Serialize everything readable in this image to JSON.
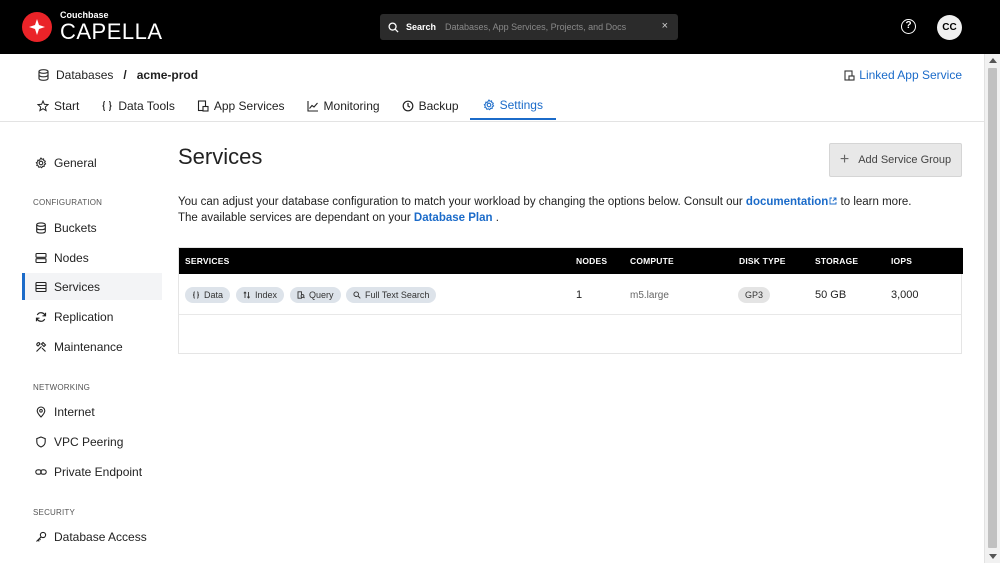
{
  "topbar": {
    "logo_small": "Couchbase",
    "logo_big": "CAPELLA",
    "search_label": "Search",
    "search_placeholder": "Databases, App Services, Projects, and Docs",
    "search_clear": "×",
    "help": "?",
    "avatar": "CC"
  },
  "header": {
    "breadcrumb_root": "Databases",
    "breadcrumb_sep": "/",
    "breadcrumb_current": "acme-prod",
    "linked_app_service": "Linked App Service",
    "tabs": [
      {
        "label": "Start"
      },
      {
        "label": "Data Tools"
      },
      {
        "label": "App Services"
      },
      {
        "label": "Monitoring"
      },
      {
        "label": "Backup"
      },
      {
        "label": "Settings"
      }
    ]
  },
  "sidebar": {
    "general": "General",
    "configuration_title": "CONFIGURATION",
    "configuration_items": [
      "Buckets",
      "Nodes",
      "Services",
      "Replication",
      "Maintenance"
    ],
    "networking_title": "NETWORKING",
    "networking_items": [
      "Internet",
      "VPC Peering",
      "Private Endpoint"
    ],
    "security_title": "SECURITY",
    "security_items": [
      "Database Access"
    ]
  },
  "main": {
    "title": "Services",
    "add_button": "Add Service Group",
    "desc_line1_a": "You can adjust your database configuration to match your workload by changing the options below. Consult our ",
    "desc_link1": "documentation",
    "desc_line1_b": " to learn more.",
    "desc_line2_a": "The available services are dependant on your ",
    "desc_link2": "Database Plan",
    "desc_line2_b": " ."
  },
  "table": {
    "headers": [
      "SERVICES",
      "NODES",
      "COMPUTE",
      "DISK TYPE",
      "STORAGE",
      "IOPS"
    ],
    "row": {
      "services": [
        "Data",
        "Index",
        "Query",
        "Full Text Search"
      ],
      "nodes": "1",
      "compute": "m5.large",
      "disk_type": "GP3",
      "storage": "50 GB",
      "iops": "3,000"
    }
  },
  "colors": {
    "accent": "#1b6bc9",
    "logo": "#ea2328",
    "topbar": "#000000"
  }
}
